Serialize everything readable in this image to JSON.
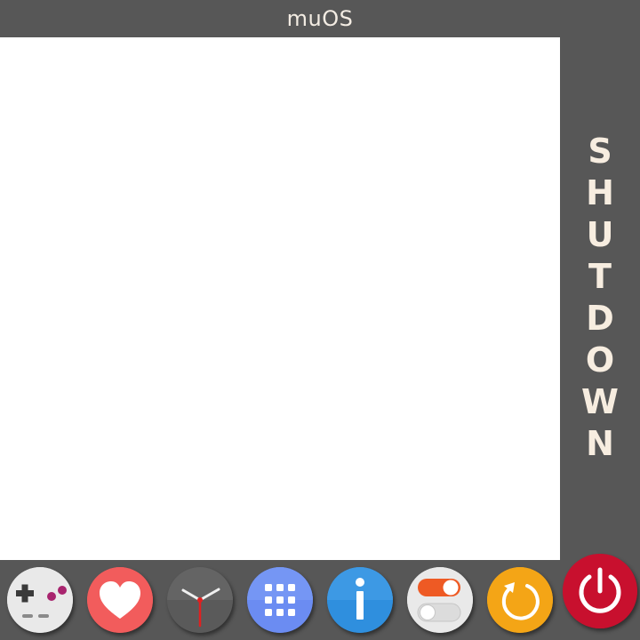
{
  "app": {
    "title": "muOS"
  },
  "side_label": "SHUTDOWN",
  "dock": {
    "items": [
      {
        "name": "explore",
        "icon": "gamepad-icon",
        "color": "#e9e9e9"
      },
      {
        "name": "favourites",
        "icon": "heart-icon",
        "color": "#f25c5c"
      },
      {
        "name": "history",
        "icon": "clock-icon",
        "color": "#5a5a5a"
      },
      {
        "name": "applications",
        "icon": "app-grid-icon",
        "color": "#6b8cf2"
      },
      {
        "name": "information",
        "icon": "info-icon",
        "color": "#2f8fde"
      },
      {
        "name": "configuration",
        "icon": "toggle-icon",
        "color": "#e9e9e9"
      },
      {
        "name": "reboot",
        "icon": "reboot-icon",
        "color": "#f4a516"
      },
      {
        "name": "shutdown",
        "icon": "power-icon",
        "color": "#c8102e",
        "selected": true
      }
    ]
  }
}
